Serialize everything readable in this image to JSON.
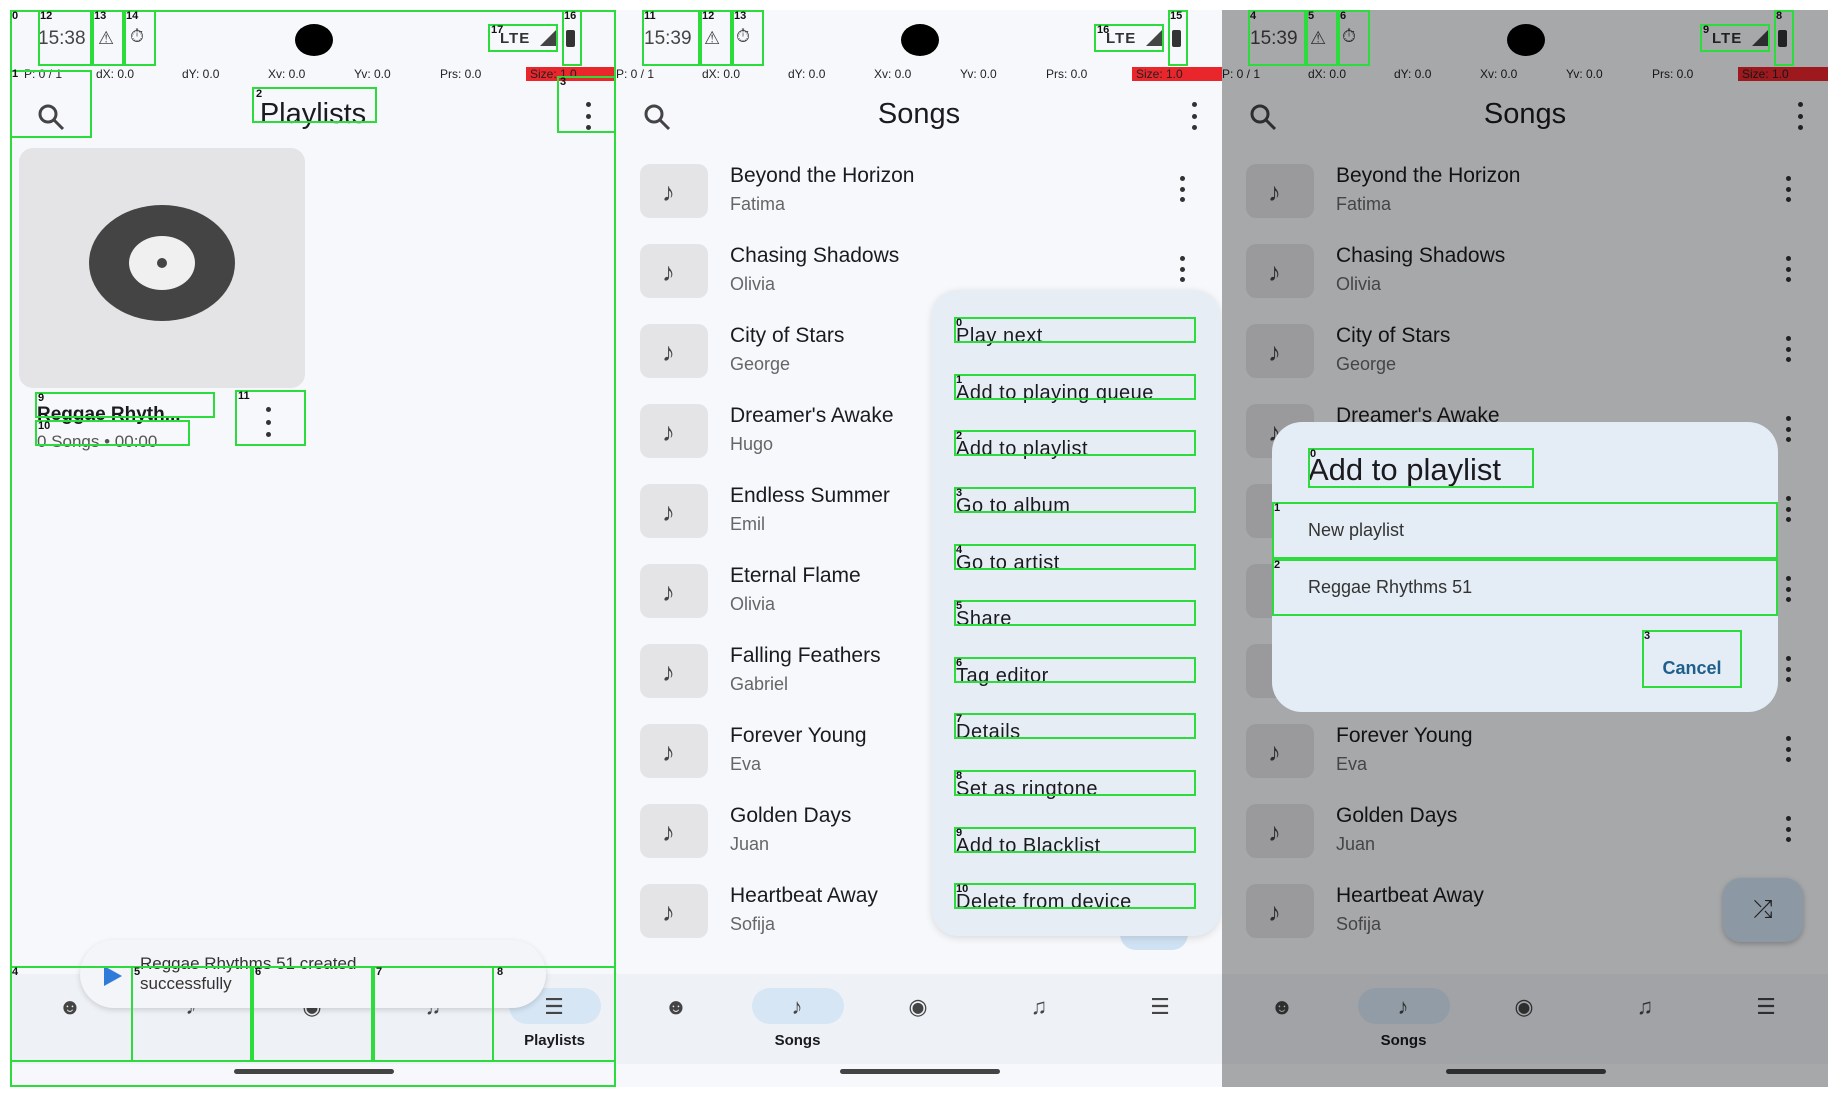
{
  "panels": [
    {
      "status": {
        "time": "15:38",
        "lte": "LTE"
      },
      "debug": {
        "p": "P: 0 / 1",
        "dx": "dX: 0.0",
        "dy": "dY: 0.0",
        "xv": "Xv: 0.0",
        "yv": "Yv: 0.0",
        "prs": "Prs: 0.0",
        "size": "Size: 1.0"
      },
      "title": "Playlists",
      "playlist": {
        "name": "Reggae Rhyth...",
        "meta": "0 Songs  •  00:00"
      },
      "toast": "Reggae Rhythms 51 created successfully",
      "nav": {
        "active_label": "Playlists"
      }
    },
    {
      "status": {
        "time": "15:39",
        "lte": "LTE"
      },
      "debug": {
        "p": "P: 0 / 1",
        "dx": "dX: 0.0",
        "dy": "dY: 0.0",
        "xv": "Xv: 0.0",
        "yv": "Yv: 0.0",
        "prs": "Prs: 0.0",
        "size": "Size: 1.0"
      },
      "title": "Songs",
      "songs": [
        {
          "title": "Beyond the Horizon",
          "artist": "Fatima"
        },
        {
          "title": "Chasing Shadows",
          "artist": "Olivia"
        },
        {
          "title": "City of Stars",
          "artist": "George"
        },
        {
          "title": "Dreamer's Awake",
          "artist": "Hugo"
        },
        {
          "title": "Endless Summer",
          "artist": "Emil"
        },
        {
          "title": "Eternal Flame",
          "artist": "Olivia"
        },
        {
          "title": "Falling Feathers",
          "artist": "Gabriel"
        },
        {
          "title": "Forever Young",
          "artist": "Eva"
        },
        {
          "title": "Golden Days",
          "artist": "Juan"
        },
        {
          "title": "Heartbeat Away",
          "artist": "Sofija"
        }
      ],
      "menu": [
        "Play next",
        "Add to playing queue",
        "Add to playlist",
        "Go to album",
        "Go to artist",
        "Share",
        "Tag editor",
        "Details",
        "Set as ringtone",
        "Add to Blacklist",
        "Delete from device"
      ],
      "nav": {
        "active_label": "Songs"
      }
    },
    {
      "status": {
        "time": "15:39",
        "lte": "LTE"
      },
      "debug": {
        "p": "P: 0 / 1",
        "dx": "dX: 0.0",
        "dy": "dY: 0.0",
        "xv": "Xv: 0.0",
        "yv": "Yv: 0.0",
        "prs": "Prs: 0.0",
        "size": "Size: 1.0"
      },
      "title": "Songs",
      "dialog": {
        "title": "Add to playlist",
        "items": [
          "New playlist",
          "Reggae Rhythms 51"
        ],
        "cancel": "Cancel"
      },
      "nav": {
        "active_label": "Songs"
      }
    }
  ],
  "colors": {
    "accent": "#d6e6f5",
    "overlay_box": "#2bdc3c",
    "debug_size_bg": "#e8262c",
    "dialog_action": "#1f5f8b"
  },
  "icons": {
    "search": "search-icon",
    "more": "more-vert-icon",
    "nav": [
      "face-icon",
      "music-note-icon",
      "album-icon",
      "artist-icon",
      "playlist-icon"
    ],
    "fab": "shuffle-icon"
  }
}
